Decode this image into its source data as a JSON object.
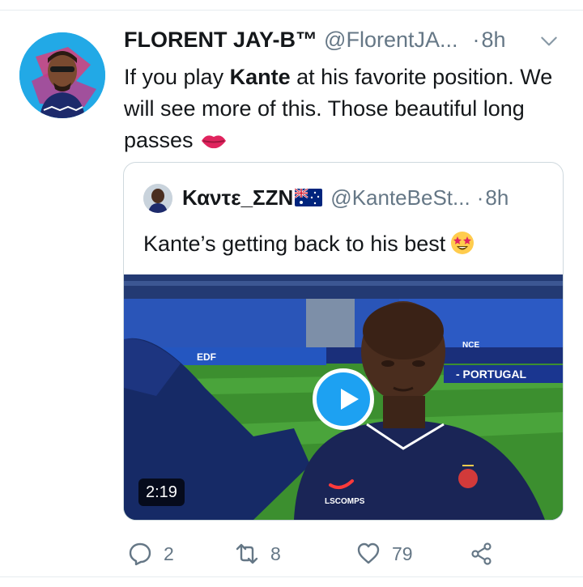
{
  "tweet": {
    "author_name": "FLORENT JAY-B™",
    "author_handle": "@FlorentJA...",
    "dot": "·",
    "time": "8h",
    "text_before": "If you play ",
    "text_bold": "Kante",
    "text_after": " at his favorite position. We will see more of this. Those beautiful long passes",
    "emoji": "kiss-mark-icon"
  },
  "quote": {
    "author_name": "Καντε_ΣΖΝ",
    "flag": "australia-flag-icon",
    "author_handle": "@KanteBeSt...",
    "dot": "·",
    "time": "8h",
    "text": "Kante’s getting back to his best",
    "emoji": "star-struck-icon",
    "video": {
      "duration": "2:19",
      "board_text": "- PORTUGAL",
      "sponsor_text": "EDF",
      "shirt_text": "LSCOMPS",
      "banner_text": "NCE"
    }
  },
  "actions": {
    "reply_count": "2",
    "retweet_count": "8",
    "like_count": "79"
  },
  "colors": {
    "accent": "#1da1f2",
    "secondary_text": "#657786",
    "border": "#cfd9de"
  }
}
